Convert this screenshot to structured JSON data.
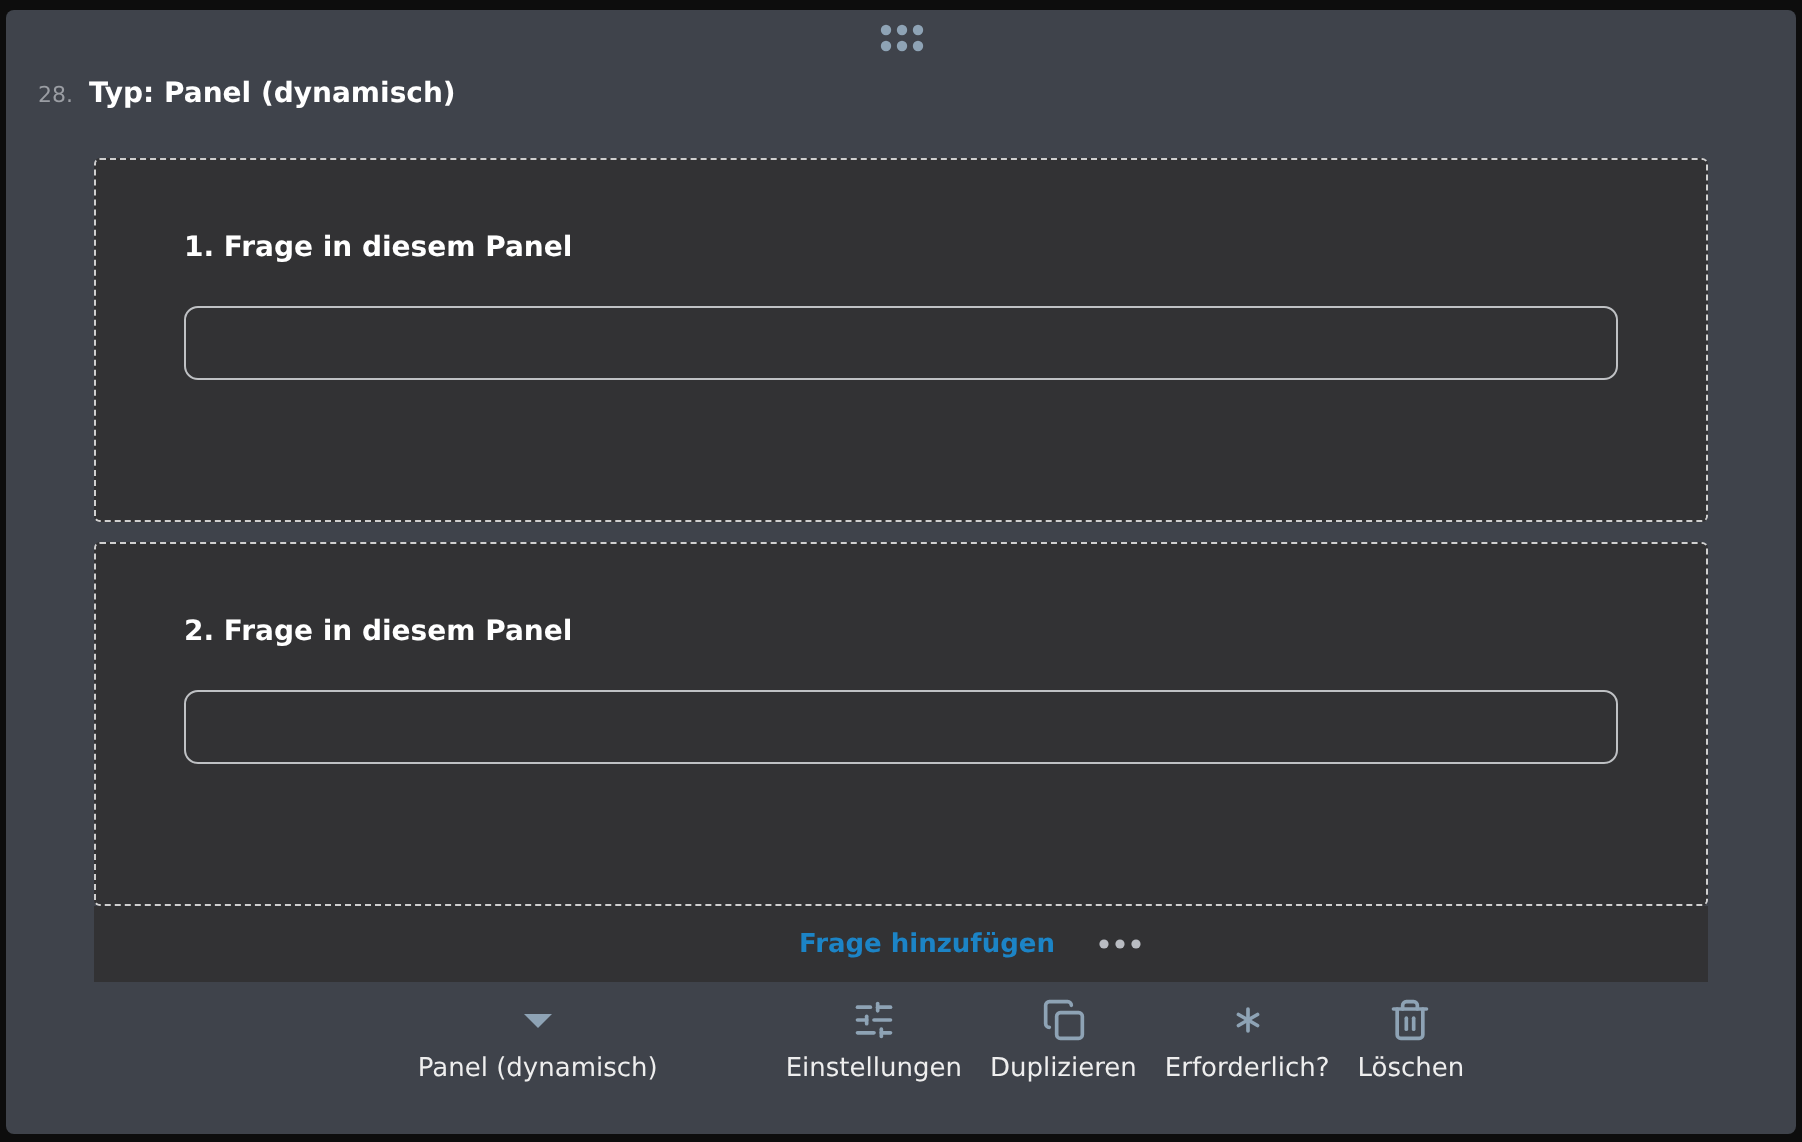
{
  "question": {
    "number": "28.",
    "title": "Typ: Panel (dynamisch)"
  },
  "panels": [
    {
      "question": "1. Frage in diesem Panel"
    },
    {
      "question": "2. Frage in diesem Panel"
    }
  ],
  "footer": {
    "add_label": "Frage hinzufügen"
  },
  "toolbar": [
    {
      "kind": "dropdown",
      "label": "Panel (dynamisch)"
    },
    {
      "kind": "settings",
      "label": "Einstellungen"
    },
    {
      "kind": "duplicate",
      "label": "Duplizieren"
    },
    {
      "kind": "required",
      "label": "Erforderlich?"
    },
    {
      "kind": "delete",
      "label": "Löschen"
    }
  ]
}
